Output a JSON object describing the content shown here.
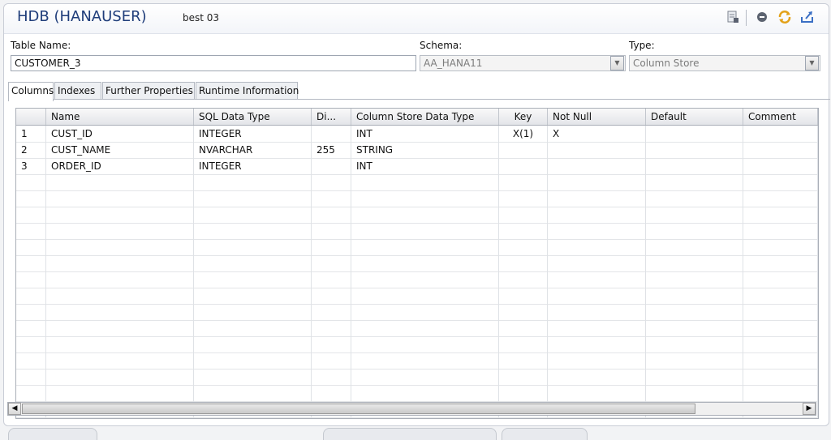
{
  "header": {
    "title": "HDB (HANAUSER)",
    "subtitle": "best 03",
    "toolbar_icons": [
      "report-icon",
      "stop-icon",
      "refresh-icon",
      "export-icon"
    ]
  },
  "form": {
    "table_name_label": "Table Name:",
    "table_name_value": "CUSTOMER_3",
    "schema_label": "Schema:",
    "schema_value": "AA_HANA11",
    "type_label": "Type:",
    "type_value": "Column Store"
  },
  "tabs": [
    {
      "label": "Columns",
      "active": true
    },
    {
      "label": "Indexes",
      "active": false
    },
    {
      "label": "Further Properties",
      "active": false
    },
    {
      "label": "Runtime Information",
      "active": false
    }
  ],
  "grid": {
    "columns": [
      "",
      "Name",
      "SQL Data Type",
      "Di...",
      "Column Store Data Type",
      "Key",
      "Not Null",
      "Default",
      "Comment"
    ],
    "rows": [
      [
        "1",
        "CUST_ID",
        "INTEGER",
        "",
        "INT",
        "X(1)",
        "X",
        "",
        ""
      ],
      [
        "2",
        "CUST_NAME",
        "NVARCHAR",
        "255",
        "STRING",
        "",
        "",
        "",
        ""
      ],
      [
        "3",
        "ORDER_ID",
        "INTEGER",
        "",
        "INT",
        "",
        "",
        "",
        ""
      ]
    ],
    "empty_rows": 15
  },
  "colors": {
    "title": "#1f3d7a",
    "accent": "#3a6fc4"
  }
}
